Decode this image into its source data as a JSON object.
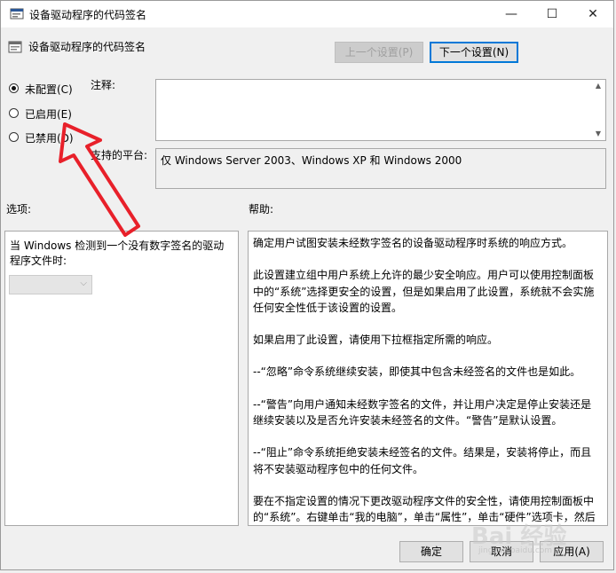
{
  "window": {
    "title": "设备驱动程序的代码签名",
    "min_glyph": "—",
    "max_glyph": "☐",
    "close_glyph": "✕"
  },
  "policy": {
    "name": "设备驱动程序的代码签名"
  },
  "nav": {
    "prev_label": "上一个设置(P)",
    "next_label": "下一个设置(N)"
  },
  "state": {
    "options": [
      {
        "label": "未配置(C)",
        "checked": true
      },
      {
        "label": "已启用(E)",
        "checked": false
      },
      {
        "label": "已禁用(D)",
        "checked": false
      }
    ]
  },
  "comment": {
    "label": "注释:",
    "value": ""
  },
  "platform": {
    "label": "支持的平台:",
    "value": "仅 Windows Server 2003、Windows XP 和 Windows 2000"
  },
  "options_panel": {
    "header": "选项:",
    "description": "当 Windows 检测到一个没有数字签名的驱动程序文件时:",
    "select_value": ""
  },
  "help_panel": {
    "header": "帮助:",
    "paragraphs": [
      "确定用户试图安装未经数字签名的设备驱动程序时系统的响应方式。",
      "此设置建立组中用户系统上允许的最少安全响应。用户可以使用控制面板中的“系统”选择更安全的设置，但是如果启用了此设置，系统就不会实施任何安全性低于该设置的设置。",
      "如果启用了此设置，请使用下拉框指定所需的响应。",
      "--“忽略”命令系统继续安装，即使其中包含未经签名的文件也是如此。",
      "--“警告”向用户通知未经数字签名的文件，并让用户决定是停止安装还是继续安装以及是否允许安装未经签名的文件。“警告”是默认设置。",
      "--“阻止”命令系统拒绝安装未经签名的文件。结果是，安装将停止，而且将不安装驱动程序包中的任何文件。",
      "要在不指定设置的情况下更改驱动程序文件的安全性，请使用控制面板中的“系统”。右键单击“我的电脑”，单击“属性”，单击“硬件”选项卡，然后单击“驱动程序签名”按钮。"
    ]
  },
  "footer": {
    "ok_label": "确定",
    "cancel_label": "取消",
    "apply_label": "应用(A)"
  },
  "colors": {
    "annotation_arrow": "#e8202a",
    "focus_border": "#0078d7"
  },
  "watermark": {
    "text": "Bai 经验",
    "sub": "jingyan.baidu.com"
  }
}
